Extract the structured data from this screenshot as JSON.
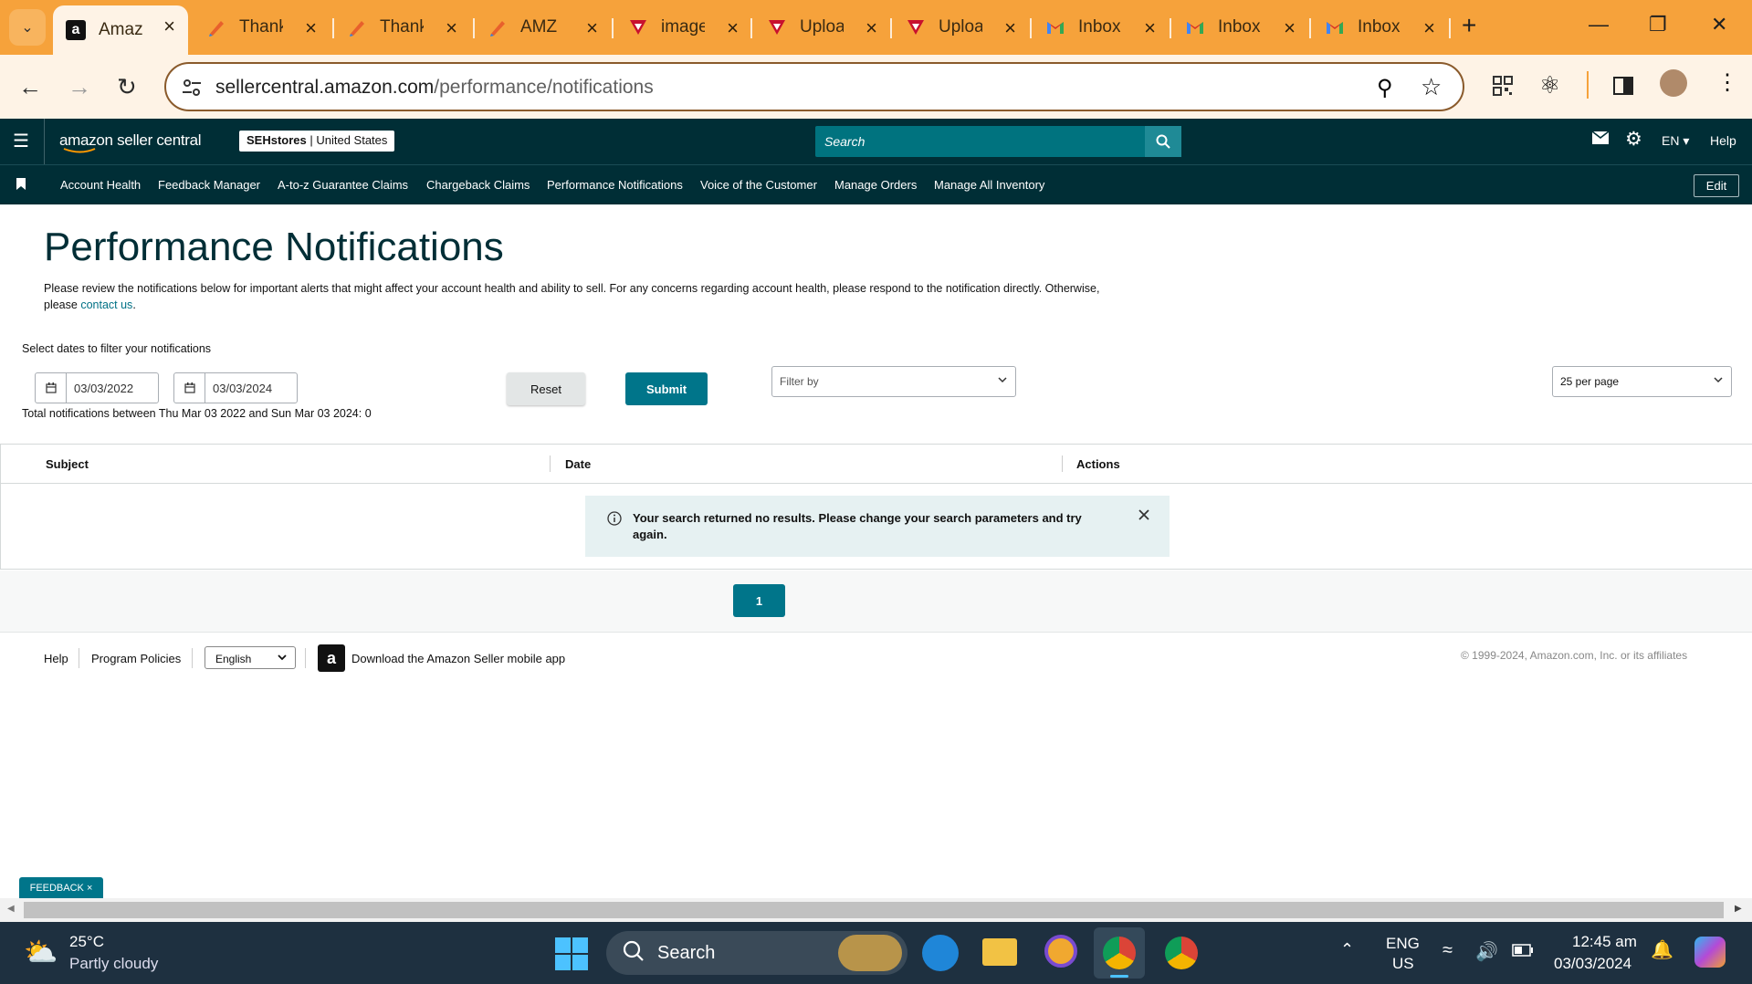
{
  "browser": {
    "tabs": [
      {
        "title": "Amazon",
        "icon": "amazon-icon",
        "active": true
      },
      {
        "title": "Thank",
        "icon": "pen-icon"
      },
      {
        "title": "Thank",
        "icon": "pen-icon"
      },
      {
        "title": "AMZ",
        "icon": "pen-icon"
      },
      {
        "title": "image",
        "icon": "upload-icon"
      },
      {
        "title": "Uploa",
        "icon": "upload-icon"
      },
      {
        "title": "Uploa",
        "icon": "upload-icon"
      },
      {
        "title": "Inbox",
        "icon": "gmail-icon"
      },
      {
        "title": "Inbox",
        "icon": "gmail-icon"
      },
      {
        "title": "Inbox",
        "icon": "gmail-icon"
      }
    ],
    "url_host": "sellercentral.amazon.com",
    "url_path": "/performance/notifications"
  },
  "header": {
    "logo": "amazon seller central",
    "store_name": "SEHstores",
    "marketplace": "United States",
    "search_placeholder": "Search",
    "language": "EN",
    "help": "Help"
  },
  "nav": {
    "items": [
      "Account Health",
      "Feedback Manager",
      "A-to-z Guarantee Claims",
      "Chargeback Claims",
      "Performance Notifications",
      "Voice of the Customer",
      "Manage Orders",
      "Manage All Inventory"
    ],
    "edit": "Edit"
  },
  "page": {
    "title": "Performance Notifications",
    "intro": "Please review the notifications below for important alerts that might affect your account health and ability to sell. For any concerns regarding account health, please respond to the notification directly. Otherwise,",
    "intro2": "please",
    "contact_link": "contact us",
    "intro_end": ".",
    "filter_label": "Select dates to filter your notifications",
    "date_from": "03/03/2022",
    "date_to": "03/03/2024",
    "reset": "Reset",
    "submit": "Submit",
    "filter_by": "Filter by",
    "per_page": "25 per page",
    "total": "Total notifications between Thu Mar 03 2022 and Sun Mar 03 2024: 0",
    "columns": [
      "Subject",
      "Date",
      "Actions"
    ],
    "no_results": "Your search returned no results. Please change your search parameters and try",
    "no_results2": "again.",
    "page_number": "1"
  },
  "footer": {
    "help": "Help",
    "policies": "Program Policies",
    "language": "English",
    "app_link": "Download the Amazon Seller mobile app",
    "copyright": "© 1999-2024, Amazon.com, Inc. or its affiliates",
    "feedback": "FEEDBACK"
  },
  "taskbar": {
    "temp": "25°C",
    "weather": "Partly cloudy",
    "search": "Search",
    "lang1": "ENG",
    "lang2": "US",
    "time": "12:45 am",
    "date": "03/03/2024"
  },
  "colors": {
    "tabstrip": "#f6a23b",
    "sc_header": "#002e36",
    "accent": "#007185",
    "submit": "#00758a"
  }
}
